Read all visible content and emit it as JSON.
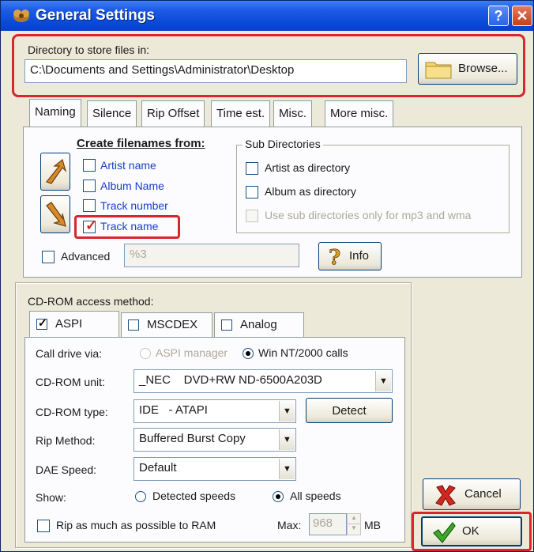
{
  "window": {
    "title": "General Settings",
    "help_label": "?",
    "close_label": "✕"
  },
  "directory": {
    "label": "Directory to store files in:",
    "path": "C:\\Documents and Settings\\Administrator\\Desktop",
    "browse_label": "Browse..."
  },
  "tabs": [
    "Naming",
    "Silence",
    "Rip Offset",
    "Time est.",
    "Misc.",
    "More misc."
  ],
  "naming": {
    "heading": "Create filenames from:",
    "items": [
      {
        "label": "Artist name",
        "checked": false,
        "color": "blue"
      },
      {
        "label": "Album Name",
        "checked": false,
        "color": "blue"
      },
      {
        "label": "Track number",
        "checked": false,
        "color": "blue"
      },
      {
        "label": "Track name",
        "checked": true,
        "color": "blue"
      }
    ],
    "subdirs": {
      "title": "Sub Directories",
      "artist": "Artist as directory",
      "album": "Album as directory",
      "mp3only": "Use sub directories only for mp3 and wma"
    },
    "advanced_label": "Advanced",
    "advanced_value": "%3",
    "info_label": "Info"
  },
  "cdrom": {
    "title": "CD-ROM access method:",
    "tabs": [
      "ASPI",
      "MSCDEX",
      "Analog"
    ],
    "call_drive_label": "Call drive via:",
    "aspi_manager": "ASPI manager",
    "winnt_calls": "Win NT/2000 calls",
    "unit_label": "CD-ROM unit:",
    "unit_value": "_NEC    DVD+RW ND-6500A203D",
    "type_label": "CD-ROM type:",
    "type_value": "IDE   - ATAPI",
    "detect_label": "Detect",
    "rip_label": "Rip Method:",
    "rip_value": "Buffered Burst Copy",
    "dae_label": "DAE Speed:",
    "dae_value": "Default",
    "show_label": "Show:",
    "detected_speeds": "Detected speeds",
    "all_speeds": "All speeds",
    "ram_label": "Rip as much as possible to RAM",
    "max_label": "Max:",
    "max_value": "968",
    "mb_label": "MB"
  },
  "buttons": {
    "cancel": "Cancel",
    "ok": "OK"
  },
  "colors": {
    "highlight_red": "#d8262c",
    "title_blue": "#0a48d8",
    "link_blue": "#1a3cc8"
  }
}
